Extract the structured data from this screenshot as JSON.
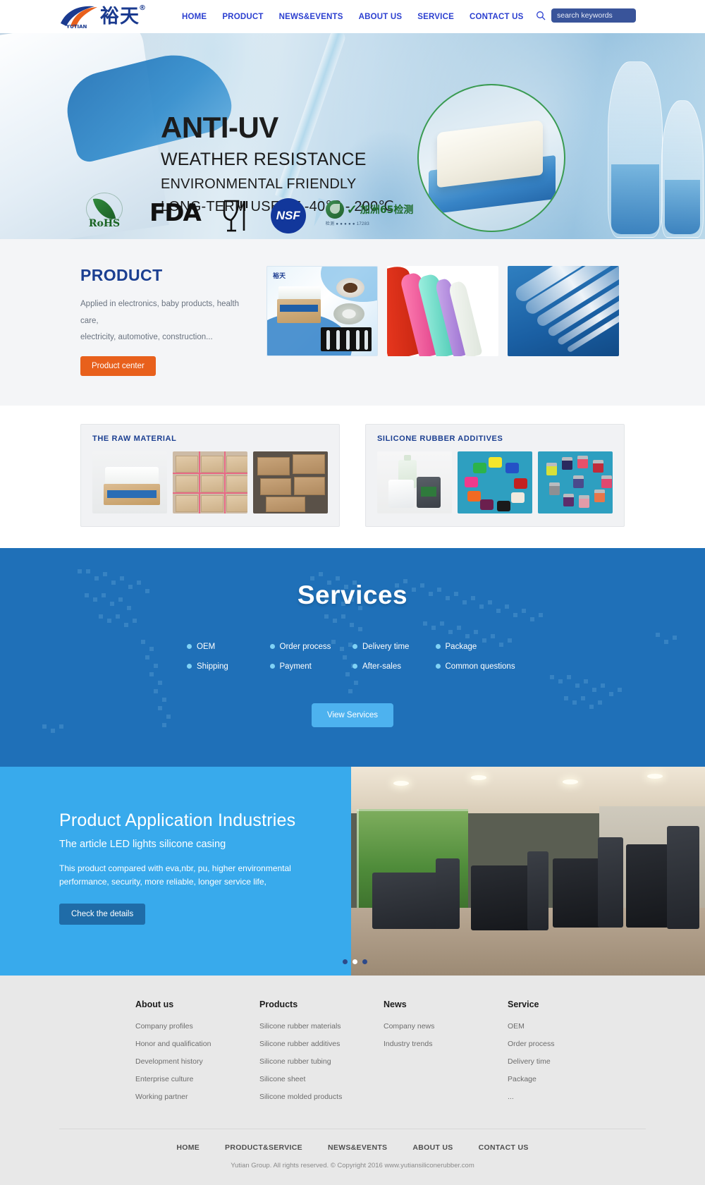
{
  "header": {
    "logo_cn": "裕天",
    "logo_reg": "®",
    "logo_en": "YUTIAN",
    "nav": [
      {
        "label": "HOME"
      },
      {
        "label": "PRODUCT"
      },
      {
        "label": "NEWS&EVENTS"
      },
      {
        "label": "ABOUT US"
      },
      {
        "label": "SERVICE"
      },
      {
        "label": "CONTACT US"
      }
    ],
    "search_placeholder": "search keywords",
    "search_value": "",
    "search_icon": "search-icon"
  },
  "hero": {
    "line1": "ANTI-UV",
    "line2": "WEATHER RESISTANCE",
    "line3": "ENVIRONMENTAL FRIENDLY",
    "line4": "LONG-TERM USE AT -40℃ - 200℃",
    "certs": [
      {
        "name": "rohs-badge",
        "label": "RoHS"
      },
      {
        "name": "fda-badge",
        "label": "FDA"
      },
      {
        "name": "food-grade-badge",
        "label": ""
      },
      {
        "name": "nsf-badge",
        "label": "NSF"
      },
      {
        "name": "california-65-badge",
        "label": "加洲65检测",
        "sub": "检测 ● ● ● ● ● 17283"
      }
    ]
  },
  "product": {
    "title": "PRODUCT",
    "desc_line1": "Applied in electronics, baby products, health care,",
    "desc_line2": "electricity, automotive, construction...",
    "button": "Product center",
    "images": [
      {
        "name": "product-image-collage"
      },
      {
        "name": "product-image-silicone-sheets"
      },
      {
        "name": "product-image-silicone-tubing"
      }
    ]
  },
  "cards": [
    {
      "title": "THE RAW MATERIAL",
      "images": [
        {
          "name": "raw-material-image-sheet-box"
        },
        {
          "name": "raw-material-image-stacked-cartons"
        },
        {
          "name": "raw-material-image-brown-boxes"
        }
      ]
    },
    {
      "title": "SILICONE RUBBER ADDITIVES",
      "images": [
        {
          "name": "additives-image-containers"
        },
        {
          "name": "additives-image-color-blocks"
        },
        {
          "name": "additives-image-pigment-jars"
        }
      ]
    }
  ],
  "services": {
    "title": "Services",
    "items": [
      {
        "label": "OEM"
      },
      {
        "label": "Order process"
      },
      {
        "label": "Delivery time"
      },
      {
        "label": "Package"
      },
      {
        "label": "Shipping"
      },
      {
        "label": "Payment"
      },
      {
        "label": "After-sales"
      },
      {
        "label": "Common questions"
      }
    ],
    "button": "View Services"
  },
  "application": {
    "title": "Product Application Industries",
    "subtitle": "The article LED lights silicone casing",
    "body_line1": "This product compared with eva,nbr, pu, higher environmental",
    "body_line2": "performance, security, more reliable, longer service life,",
    "button": "Check the details",
    "image_name": "gym-interior-photo",
    "carousel": {
      "total": 3,
      "active": 2
    }
  },
  "footer": {
    "columns": [
      {
        "heading": "About us",
        "items": [
          "Company profiles",
          "Honor and qualification",
          "Development history",
          "Enterprise culture",
          "Working partner"
        ]
      },
      {
        "heading": "Products",
        "items": [
          "Silicone rubber materials",
          "Silicone rubber additives",
          "Silicone rubber tubing",
          "Silicone sheet",
          "Silicone molded products"
        ]
      },
      {
        "heading": "News",
        "items": [
          "Company news",
          "Industry trends"
        ]
      },
      {
        "heading": "Service",
        "items": [
          "OEM",
          "Order process",
          "Delivery time",
          "Package",
          "..."
        ]
      }
    ],
    "bottom_nav": [
      "HOME",
      "PRODUCT&SERVICE",
      "NEWS&EVENTS",
      "ABOUT US",
      "CONTACT US"
    ],
    "copyright": "Yutian Group. All rights reserved. © Copyright 2016 www.yutiansiliconerubber.com"
  },
  "colors": {
    "brand_blue": "#1b3f91",
    "nav_blue": "#2b3fd0",
    "orange": "#e8601c",
    "services_blue": "#1f70b8",
    "app_blue": "#38aaec",
    "light_blue_btn": "#4db2ef",
    "dark_blue_btn": "#1f6ca8"
  }
}
